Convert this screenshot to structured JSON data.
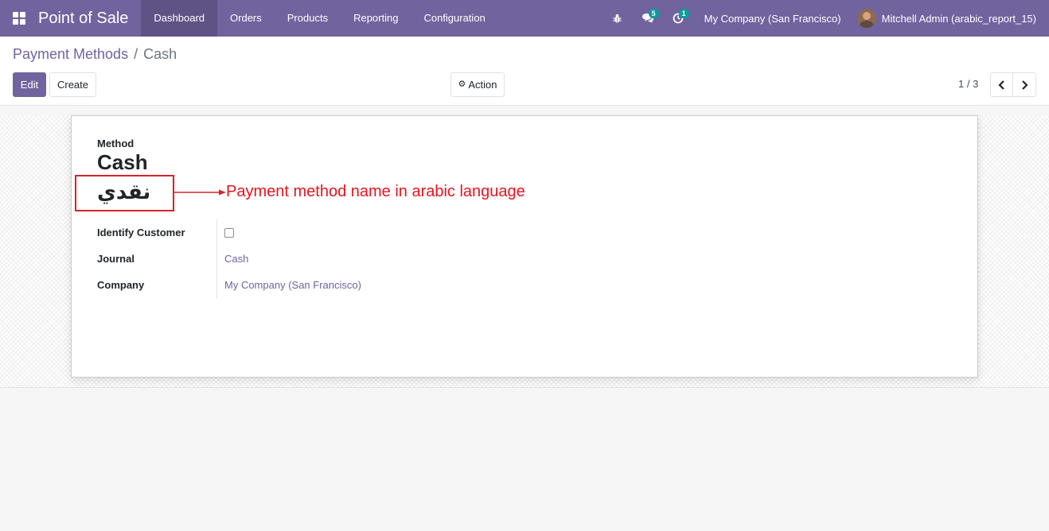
{
  "navbar": {
    "brand": "Point of Sale",
    "menu": [
      {
        "label": "Dashboard",
        "active": true
      },
      {
        "label": "Orders"
      },
      {
        "label": "Products"
      },
      {
        "label": "Reporting"
      },
      {
        "label": "Configuration"
      }
    ],
    "messages_badge": "5",
    "activities_badge": "1",
    "company": "My Company (San Francisco)",
    "user": "Mitchell Admin (arabic_report_15)",
    "accent_color": "#71639e"
  },
  "breadcrumb": {
    "parent": "Payment Methods",
    "separator": "/",
    "current": "Cash"
  },
  "buttons": {
    "edit": "Edit",
    "create": "Create",
    "action": "Action"
  },
  "pager": {
    "value": "1 / 3"
  },
  "form": {
    "title_label": "Method",
    "name_en": "Cash",
    "name_ar": "نقدي",
    "annotation": "Payment method name in arabic language",
    "annotation_color": "#e8141e",
    "fields": [
      {
        "label": "Identify Customer",
        "type": "checkbox",
        "checked": false
      },
      {
        "label": "Journal",
        "value": "Cash"
      },
      {
        "label": "Company",
        "value": "My Company (San Francisco)"
      }
    ]
  }
}
